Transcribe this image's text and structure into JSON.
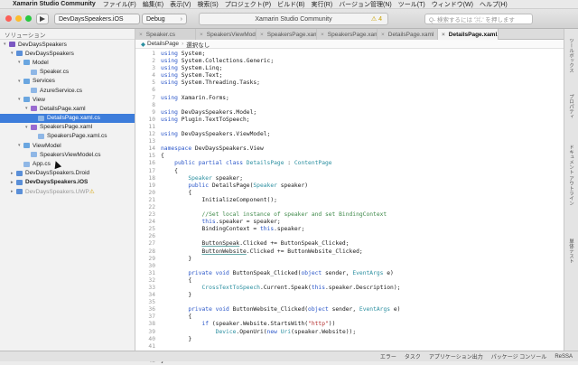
{
  "menubar": {
    "apple": "",
    "app_name": "Xamarin Studio Community",
    "items": [
      "ファイル(F)",
      "編集(E)",
      "表示(V)",
      "検索(S)",
      "プロジェクト(P)",
      "ビルド(B)",
      "実行(R)",
      "バージョン管理(N)",
      "ツール(T)",
      "ウィンドウ(W)",
      "ヘルプ(H)"
    ]
  },
  "toolbar": {
    "project": "DevDaysSpeakers.iOS",
    "config": "Debug",
    "status": "Xamarin Studio Community",
    "warning_count": "4",
    "search_placeholder": "Q- 検索するには '⌘.' を押します"
  },
  "sidebar": {
    "title": "ソリューション",
    "rows": [
      {
        "label": "DevDaysSpeakers",
        "indent": 0,
        "icon": "solution-icon",
        "arrow": "▾"
      },
      {
        "label": "DevDaysSpeakers",
        "indent": 1,
        "icon": "project-icon",
        "arrow": "▾"
      },
      {
        "label": "Model",
        "indent": 2,
        "icon": "folder-icon",
        "arrow": "▾"
      },
      {
        "label": "Speaker.cs",
        "indent": 3,
        "icon": "cs-file-icon",
        "arrow": ""
      },
      {
        "label": "Services",
        "indent": 2,
        "icon": "folder-icon",
        "arrow": "▾"
      },
      {
        "label": "AzureService.cs",
        "indent": 3,
        "icon": "cs-file-icon",
        "arrow": ""
      },
      {
        "label": "View",
        "indent": 2,
        "icon": "folder-icon",
        "arrow": "▾"
      },
      {
        "label": "DetailsPage.xaml",
        "indent": 3,
        "icon": "xaml-file-icon",
        "arrow": "▾"
      },
      {
        "label": "DetailsPage.xaml.cs",
        "indent": 4,
        "icon": "cs-file-icon",
        "arrow": "",
        "selected": true
      },
      {
        "label": "SpeakersPage.xaml",
        "indent": 3,
        "icon": "xaml-file-icon",
        "arrow": "▾"
      },
      {
        "label": "SpeakersPage.xaml.cs",
        "indent": 4,
        "icon": "cs-file-icon",
        "arrow": ""
      },
      {
        "label": "ViewModel",
        "indent": 2,
        "icon": "folder-icon",
        "arrow": "▾"
      },
      {
        "label": "SpeakersViewModel.cs",
        "indent": 3,
        "icon": "cs-file-icon",
        "arrow": ""
      },
      {
        "label": "App.cs",
        "indent": 2,
        "icon": "cs-file-icon",
        "arrow": ""
      },
      {
        "label": "DevDaysSpeakers.Droid",
        "indent": 1,
        "icon": "project-icon",
        "arrow": "▸"
      },
      {
        "label": "DevDaysSpeakers.iOS",
        "indent": 1,
        "icon": "project-icon",
        "arrow": "▸",
        "bold": true
      },
      {
        "label": "DevDaysSpeakers.UWP",
        "indent": 1,
        "icon": "project-icon",
        "arrow": "▸",
        "dim": true,
        "warn": true
      }
    ]
  },
  "tabs": [
    {
      "label": "Speaker.cs",
      "active": false
    },
    {
      "label": "SpeakersViewModel.cs",
      "active": false
    },
    {
      "label": "SpeakersPage.xaml",
      "active": false
    },
    {
      "label": "SpeakersPage.xaml.cs",
      "active": false
    },
    {
      "label": "DetailsPage.xaml",
      "active": false
    },
    {
      "label": "DetailsPage.xaml.cs",
      "active": true
    }
  ],
  "breadcrumb": {
    "class_name": "DetailsPage",
    "member": "選択なし"
  },
  "code": [
    [
      [
        "kw",
        "using"
      ],
      [
        "tx",
        " System;"
      ]
    ],
    [
      [
        "kw",
        "using"
      ],
      [
        "tx",
        " System.Collections.Generic;"
      ]
    ],
    [
      [
        "kw",
        "using"
      ],
      [
        "tx",
        " System.Linq;"
      ]
    ],
    [
      [
        "kw",
        "using"
      ],
      [
        "tx",
        " System.Text;"
      ]
    ],
    [
      [
        "kw",
        "using"
      ],
      [
        "tx",
        " System.Threading.Tasks;"
      ]
    ],
    [],
    [
      [
        "kw",
        "using"
      ],
      [
        "tx",
        " Xamarin.Forms;"
      ]
    ],
    [],
    [
      [
        "kw",
        "using"
      ],
      [
        "tx",
        " DevDaysSpeakers.Model;"
      ]
    ],
    [
      [
        "kw",
        "using"
      ],
      [
        "tx",
        " Plugin.TextToSpeech;"
      ]
    ],
    [],
    [
      [
        "kw",
        "using"
      ],
      [
        "tx",
        " DevDaysSpeakers.ViewModel;"
      ]
    ],
    [],
    [
      [
        "kw",
        "namespace"
      ],
      [
        "tx",
        " DevDaysSpeakers.View"
      ]
    ],
    [
      [
        "tx",
        "{"
      ]
    ],
    [
      [
        "tx",
        "    "
      ],
      [
        "kw",
        "public partial class"
      ],
      [
        "tx",
        " "
      ],
      [
        "ty",
        "DetailsPage"
      ],
      [
        "tx",
        " : "
      ],
      [
        "ty",
        "ContentPage"
      ]
    ],
    [
      [
        "tx",
        "    {"
      ]
    ],
    [
      [
        "tx",
        "        "
      ],
      [
        "ty",
        "Speaker"
      ],
      [
        "tx",
        " speaker;"
      ]
    ],
    [
      [
        "tx",
        "        "
      ],
      [
        "kw",
        "public"
      ],
      [
        "tx",
        " DetailsPage("
      ],
      [
        "ty",
        "Speaker"
      ],
      [
        "tx",
        " speaker)"
      ]
    ],
    [
      [
        "tx",
        "        {"
      ]
    ],
    [
      [
        "tx",
        "            InitializeComponent();"
      ]
    ],
    [],
    [
      [
        "tx",
        "            "
      ],
      [
        "cm",
        "//Set local instance of speaker and set BindingContext"
      ]
    ],
    [
      [
        "tx",
        "            "
      ],
      [
        "kw",
        "this"
      ],
      [
        "tx",
        ".speaker = speaker;"
      ]
    ],
    [
      [
        "tx",
        "            BindingContext = "
      ],
      [
        "kw",
        "this"
      ],
      [
        "tx",
        ".speaker;"
      ]
    ],
    [],
    [
      [
        "tx",
        "            "
      ],
      [
        "ul",
        "ButtonSpeak"
      ],
      [
        "tx",
        ".Clicked += ButtonSpeak_Clicked;"
      ]
    ],
    [
      [
        "tx",
        "            "
      ],
      [
        "ul",
        "ButtonWebsite"
      ],
      [
        "tx",
        ".Clicked += ButtonWebsite_Clicked;"
      ]
    ],
    [
      [
        "tx",
        "        }"
      ]
    ],
    [],
    [
      [
        "tx",
        "        "
      ],
      [
        "kw",
        "private void"
      ],
      [
        "tx",
        " ButtonSpeak_Clicked("
      ],
      [
        "kw",
        "object"
      ],
      [
        "tx",
        " sender, "
      ],
      [
        "ty",
        "EventArgs"
      ],
      [
        "tx",
        " e)"
      ]
    ],
    [
      [
        "tx",
        "        {"
      ]
    ],
    [
      [
        "tx",
        "            "
      ],
      [
        "ty",
        "CrossTextToSpeech"
      ],
      [
        "tx",
        ".Current.Speak("
      ],
      [
        "kw",
        "this"
      ],
      [
        "tx",
        ".speaker.Description);"
      ]
    ],
    [
      [
        "tx",
        "        }"
      ]
    ],
    [],
    [
      [
        "tx",
        "        "
      ],
      [
        "kw",
        "private void"
      ],
      [
        "tx",
        " ButtonWebsite_Clicked("
      ],
      [
        "kw",
        "object"
      ],
      [
        "tx",
        " sender, "
      ],
      [
        "ty",
        "EventArgs"
      ],
      [
        "tx",
        " e)"
      ]
    ],
    [
      [
        "tx",
        "        {"
      ]
    ],
    [
      [
        "tx",
        "            "
      ],
      [
        "kw",
        "if"
      ],
      [
        "tx",
        " (speaker.Website.StartsWith("
      ],
      [
        "st",
        "\"http\""
      ],
      [
        "tx",
        "))"
      ]
    ],
    [
      [
        "tx",
        "                "
      ],
      [
        "ty",
        "Device"
      ],
      [
        "tx",
        ".OpenUri("
      ],
      [
        "kw",
        "new"
      ],
      [
        "tx",
        " "
      ],
      [
        "ty",
        "Uri"
      ],
      [
        "tx",
        "(speaker.Website));"
      ]
    ],
    [
      [
        "tx",
        "        }"
      ]
    ],
    [],
    [
      [
        "tx",
        "    }"
      ]
    ],
    [
      [
        "tx",
        "}"
      ]
    ]
  ],
  "rightbar": [
    "ツールボックス",
    "プロパティ",
    "ドキュメント アウトライン",
    "単体テスト"
  ],
  "statusbar": [
    "エラー",
    "タスク",
    "アプリケーション出力",
    "パッケージ コンソール",
    "ReSSA"
  ],
  "colors": {
    "selection": "#3d7ddb",
    "keyword": "#2b57c9",
    "type": "#2b8fa0",
    "comment": "#3f8a4a"
  }
}
